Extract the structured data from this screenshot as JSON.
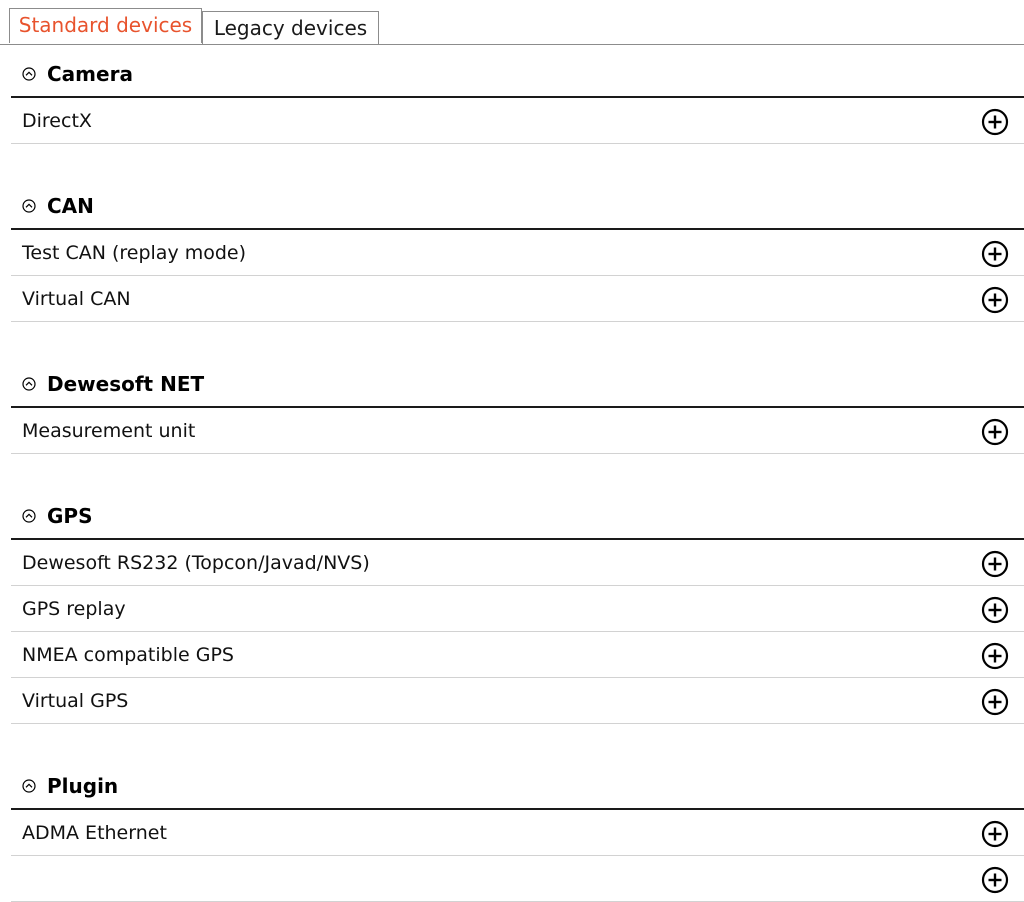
{
  "tabs": [
    {
      "label": "Standard devices",
      "active": true
    },
    {
      "label": "Legacy devices",
      "active": false
    }
  ],
  "groups": [
    {
      "title": "Camera",
      "items": [
        "DirectX"
      ]
    },
    {
      "title": "CAN",
      "items": [
        "Test CAN (replay mode)",
        "Virtual CAN"
      ]
    },
    {
      "title": "Dewesoft NET",
      "items": [
        "Measurement unit"
      ]
    },
    {
      "title": "GPS",
      "items": [
        "Dewesoft RS232 (Topcon/Javad/NVS)",
        "GPS replay",
        "NMEA compatible GPS",
        "Virtual GPS"
      ]
    },
    {
      "title": "Plugin",
      "items": [
        "ADMA Ethernet"
      ]
    }
  ],
  "icons": {
    "collapse": "chevron-up-circle-icon",
    "add": "plus-circle-icon"
  },
  "colors": {
    "active_tab_text": "#e8532d",
    "header_rule": "#1a1a1a",
    "row_rule": "#d2d2d2"
  }
}
